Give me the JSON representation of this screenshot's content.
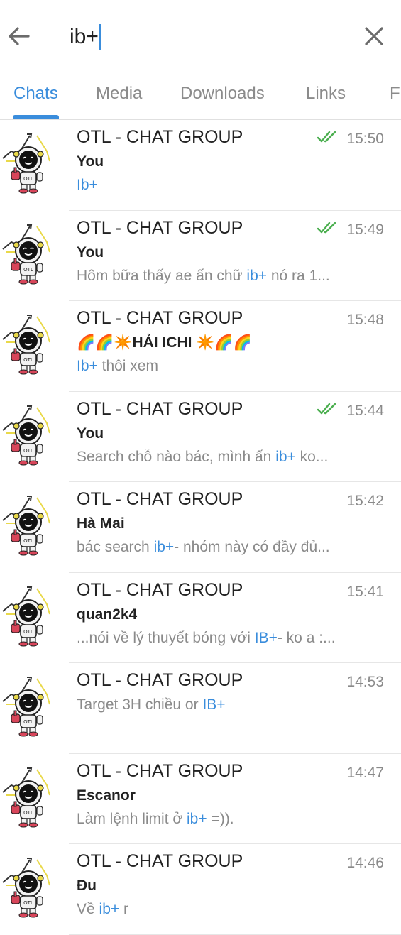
{
  "search": {
    "query": "ib+"
  },
  "tabs": [
    "Chats",
    "Media",
    "Downloads",
    "Links",
    "F"
  ],
  "colors": {
    "accent": "#3a8ddc",
    "check": "#4caf50",
    "muted": "#8a8a8a"
  },
  "results": [
    {
      "title": "OTL - CHAT GROUP",
      "time": "15:50",
      "read": true,
      "sender": "You",
      "preview": [
        {
          "t": "Ib+",
          "h": true
        }
      ]
    },
    {
      "title": "OTL - CHAT GROUP",
      "time": "15:49",
      "read": true,
      "sender": "You",
      "preview": [
        {
          "t": "Hôm bữa thấy ae ấn chữ ",
          "h": false
        },
        {
          "t": "ib+",
          "h": true
        },
        {
          "t": " nó ra 1...",
          "h": false
        }
      ]
    },
    {
      "title": "OTL - CHAT GROUP",
      "time": "15:48",
      "read": false,
      "sender": "🌈🌈✴️HẢI ICHI ✴️🌈🌈",
      "preview": [
        {
          "t": "Ib+",
          "h": true
        },
        {
          "t": " thôi xem",
          "h": false
        }
      ]
    },
    {
      "title": "OTL - CHAT GROUP",
      "time": "15:44",
      "read": true,
      "sender": "You",
      "preview": [
        {
          "t": "Search chỗ nào bác, mình ấn ",
          "h": false
        },
        {
          "t": "ib+",
          "h": true
        },
        {
          "t": " ko...",
          "h": false
        }
      ]
    },
    {
      "title": "OTL - CHAT GROUP",
      "time": "15:42",
      "read": false,
      "sender": "Hà Mai",
      "preview": [
        {
          "t": "bác search ",
          "h": false
        },
        {
          "t": "ib+",
          "h": true
        },
        {
          "t": "- nhóm này có đầy đủ...",
          "h": false
        }
      ]
    },
    {
      "title": "OTL - CHAT GROUP",
      "time": "15:41",
      "read": false,
      "sender": "quan2k4",
      "preview": [
        {
          "t": "...nói về lý thuyết bóng với ",
          "h": false
        },
        {
          "t": "IB+",
          "h": true
        },
        {
          "t": "- ko a :...",
          "h": false
        }
      ]
    },
    {
      "title": "OTL - CHAT GROUP",
      "time": "14:53",
      "read": false,
      "sender": "",
      "preview": [
        {
          "t": "Target 3H chiều or ",
          "h": false
        },
        {
          "t": "IB+",
          "h": true
        }
      ]
    },
    {
      "title": "OTL - CHAT GROUP",
      "time": "14:47",
      "read": false,
      "sender": "Escanor",
      "preview": [
        {
          "t": "Làm lệnh limit ở ",
          "h": false
        },
        {
          "t": "ib+",
          "h": true
        },
        {
          "t": " =)).",
          "h": false
        }
      ]
    },
    {
      "title": "OTL - CHAT GROUP",
      "time": "14:46",
      "read": false,
      "sender": "Đu",
      "preview": [
        {
          "t": "Về ",
          "h": false
        },
        {
          "t": "ib+",
          "h": true
        },
        {
          "t": " r",
          "h": false
        }
      ]
    }
  ]
}
